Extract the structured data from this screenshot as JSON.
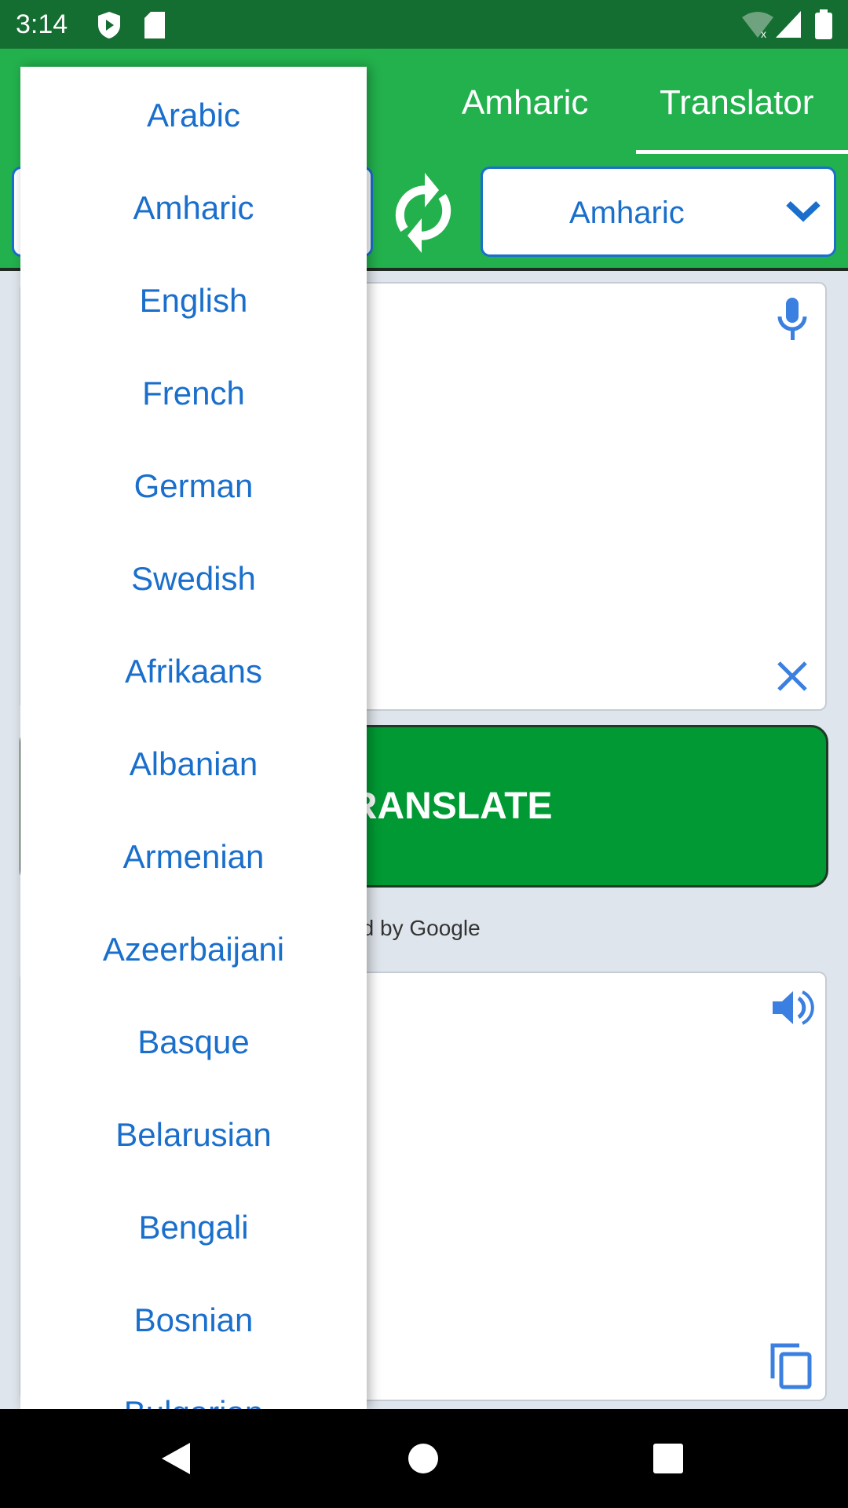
{
  "status_bar": {
    "time": "3:14",
    "icons": [
      "shield-play-icon",
      "sd-card-icon",
      "wifi-off-icon",
      "signal-icon",
      "battery-icon"
    ]
  },
  "tabs": [
    {
      "label": "Amharic",
      "selected": false
    },
    {
      "label": "Translator",
      "selected": true
    }
  ],
  "target_language": {
    "value": "Amharic"
  },
  "translate_button": {
    "label": "TRANSLATE"
  },
  "attribution": "Translated by Google",
  "dropdown": {
    "items": [
      "Arabic",
      "Amharic",
      "English",
      "French",
      "German",
      "Swedish",
      "Afrikaans",
      "Albanian",
      "Armenian",
      "Azeerbaijani",
      "Basque",
      "Belarusian",
      "Bengali",
      "Bosnian",
      "Bulgarian"
    ]
  },
  "colors": {
    "appbar": "#23b14d",
    "status": "#146d31",
    "accent": "#1a6fcc",
    "button": "#009933"
  }
}
